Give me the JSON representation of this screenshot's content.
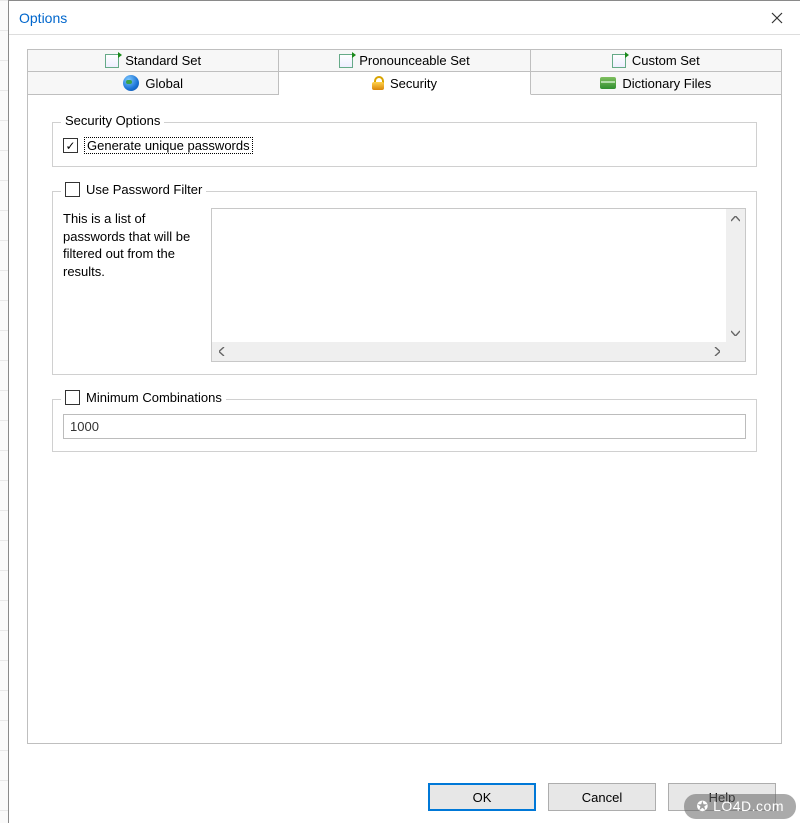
{
  "window": {
    "title": "Options"
  },
  "tabs": {
    "top": [
      {
        "label": "Standard Set",
        "icon": "doc"
      },
      {
        "label": "Pronounceable Set",
        "icon": "doc"
      },
      {
        "label": "Custom Set",
        "icon": "doc"
      }
    ],
    "bottom": [
      {
        "label": "Global",
        "icon": "globe"
      },
      {
        "label": "Security",
        "icon": "lock",
        "active": true
      },
      {
        "label": "Dictionary Files",
        "icon": "dict"
      }
    ]
  },
  "security": {
    "options_legend": "Security Options",
    "generate_unique": {
      "label": "Generate unique passwords",
      "checked": true
    },
    "filter": {
      "label": "Use Password Filter",
      "checked": false,
      "description": "This is a list of passwords that will be filtered out from the results.",
      "value": ""
    },
    "min_combinations": {
      "label": "Minimum Combinations",
      "checked": false,
      "value": "1000"
    }
  },
  "buttons": {
    "ok": "OK",
    "cancel": "Cancel",
    "help": "Help"
  },
  "watermark": "✪ LO4D.com"
}
